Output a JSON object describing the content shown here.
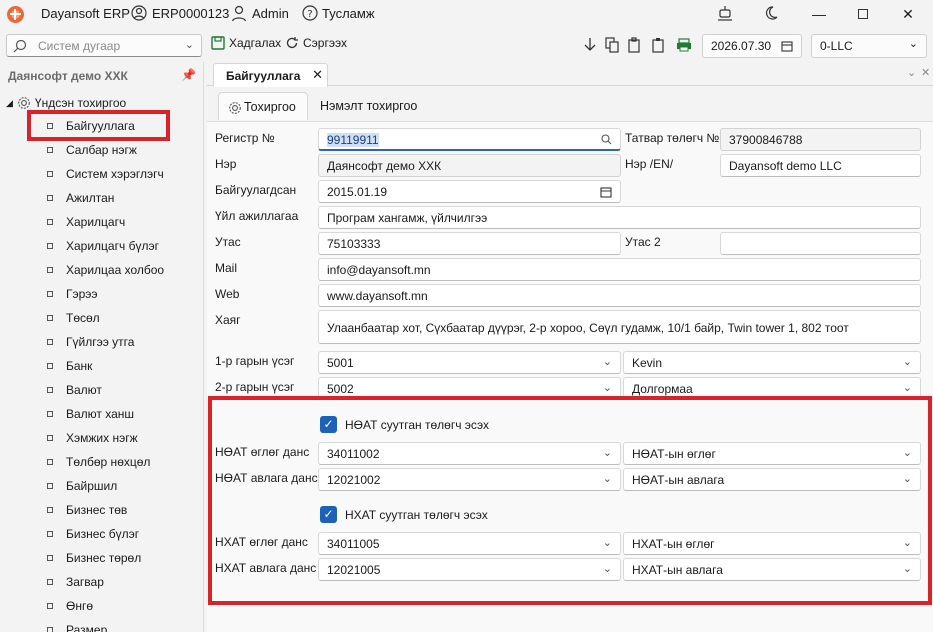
{
  "titlebar": {
    "app_name": "Dayansoft ERP",
    "doc_code": "ERP0000123",
    "user": "Admin",
    "help": "Тусламж"
  },
  "toolbar": {
    "search_placeholder": "Систем дугаар",
    "save_label": "Хадгалах",
    "refresh_label": "Сэргээх",
    "date_value": "2026.07.30",
    "org_value": "0-LLC"
  },
  "sidebar": {
    "title": "Даянсофт демо ХХК",
    "root_label": "Үндсэн тохиргоо",
    "items": [
      "Байгууллага",
      "Салбар нэгж",
      "Систем хэрэглэгч",
      "Ажилтан",
      "Харилцагч",
      "Харилцагч бүлэг",
      "Харилцаа холбоо",
      "Гэрээ",
      "Төсөл",
      "Гүйлгээ утга",
      "Банк",
      "Валют",
      "Валют ханш",
      "Хэмжих нэгж",
      "Төлбөр нөхцөл",
      "Байршил",
      "Бизнес төв",
      "Бизнес бүлэг",
      "Бизнес төрөл",
      "Загвар",
      "Өнгө",
      "Размер"
    ]
  },
  "doc_tab": {
    "label": "Байгууллага"
  },
  "subtabs": {
    "settings": "Тохиргоо",
    "extra": "Нэмэлт тохиргоо"
  },
  "form": {
    "reg_label": "Регистр №",
    "reg_value": "99119911",
    "tax_label": "Татвар төлөгч №",
    "tax_value": "37900846788",
    "name_label": "Нэр",
    "name_value": "Даянсофт демо ХХК",
    "name_en_label": "Нэр /EN/",
    "name_en_value": "Dayansoft demo LLC",
    "founded_label": "Байгуулагдсан",
    "founded_value": "2015.01.19",
    "activity_label": "Үйл ажиллагаа",
    "activity_value": "Програм хангамж, үйлчилгээ",
    "phone_label": "Утас",
    "phone_value": "75103333",
    "phone2_label": "Утас 2",
    "phone2_value": "",
    "mail_label": "Mail",
    "mail_value": "info@dayansoft.mn",
    "web_label": "Web",
    "web_value": "www.dayansoft.mn",
    "address_label": "Хаяг",
    "address_value": "Улаанбаатар хот, Сүхбаатар дүүрэг, 2-р хороо, Сөүл гудамж, 10/1 байр, Twin tower 1, 802 тоот",
    "sign1_label": "1-р гарын үсэг",
    "sign1_code": "5001",
    "sign1_name": "Kevin",
    "sign2_label": "2-р гарын үсэг",
    "sign2_code": "5002",
    "sign2_name": "Долгормаа",
    "vat_check_label": "НӨАТ суутган төлөгч эсэх",
    "vat_pay_label": "НӨАТ өглөг данс",
    "vat_pay_code": "34011002",
    "vat_pay_name": "НӨАТ-ын өглөг",
    "vat_rec_label": "НӨАТ авлага данс",
    "vat_rec_code": "12021002",
    "vat_rec_name": "НӨАТ-ын авлага",
    "nhat_check_label": "НХАТ суутган төлөгч эсэх",
    "nhat_pay_label": "НХАТ өглөг данс",
    "nhat_pay_code": "34011005",
    "nhat_pay_name": "НХАТ-ын өглөг",
    "nhat_rec_label": "НХАТ авлага данс",
    "nhat_rec_code": "12021005",
    "nhat_rec_name": "НХАТ-ын авлага"
  },
  "colors": {
    "accent": "#1d62b9",
    "highlight_red": "#d9222a"
  }
}
